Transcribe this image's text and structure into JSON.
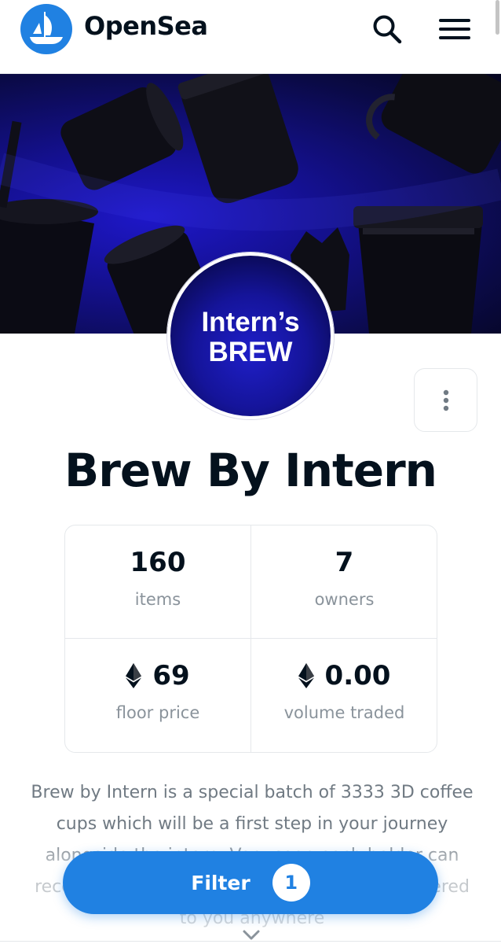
{
  "header": {
    "brand": "OpenSea",
    "logo_icon": "opensea-ship-icon",
    "search_icon": "search-icon",
    "menu_icon": "hamburger-menu-icon"
  },
  "banner": {
    "description": "dark cups on blue background",
    "colors": {
      "primary": "#1a16b8",
      "dark": "#05051f"
    }
  },
  "avatar": {
    "line1": "Intern’s",
    "line2": "BREW"
  },
  "more_options_icon": "vertical-ellipsis-icon",
  "collection": {
    "title": "Brew By Intern"
  },
  "stats": [
    {
      "value": "160",
      "label": "items",
      "icon": null
    },
    {
      "value": "7",
      "label": "owners",
      "icon": null
    },
    {
      "value": "69",
      "label": "floor price",
      "icon": "ethereum-icon"
    },
    {
      "value": "0.00",
      "label": "volume traded",
      "icon": "ethereum-icon"
    }
  ],
  "description": "Brew by Intern is a special batch of 3333 3D coffee cups which will be a first step in your journey alongside the intern. Very soon each holder can receive their unique inspiring coffee cup delivered to you anywhere",
  "filter": {
    "label": "Filter",
    "count": "1"
  },
  "colors": {
    "accent": "#2081e2",
    "text": "#04111d",
    "muted": "#8a939b",
    "border": "#e5e8eb"
  },
  "chevron_icon": "chevron-down-icon"
}
